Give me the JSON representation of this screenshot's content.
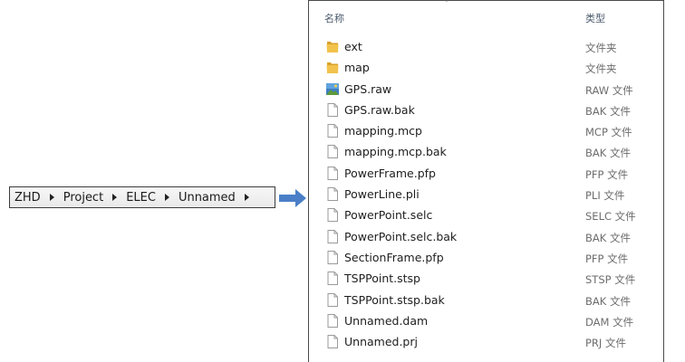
{
  "breadcrumb": {
    "items": [
      "ZHD",
      "Project",
      "ELEC",
      "Unnamed"
    ]
  },
  "explorer": {
    "columns": {
      "name": "名称",
      "type": "类型"
    },
    "files": [
      {
        "name": "ext",
        "type": "文件夹",
        "icon": "folder-icon"
      },
      {
        "name": "map",
        "type": "文件夹",
        "icon": "folder-icon"
      },
      {
        "name": "GPS.raw",
        "type": "RAW 文件",
        "icon": "image-file-icon"
      },
      {
        "name": "GPS.raw.bak",
        "type": "BAK 文件",
        "icon": "file-icon"
      },
      {
        "name": "mapping.mcp",
        "type": "MCP 文件",
        "icon": "file-icon"
      },
      {
        "name": "mapping.mcp.bak",
        "type": "BAK 文件",
        "icon": "file-icon"
      },
      {
        "name": "PowerFrame.pfp",
        "type": "PFP 文件",
        "icon": "file-icon"
      },
      {
        "name": "PowerLine.pli",
        "type": "PLI 文件",
        "icon": "file-icon"
      },
      {
        "name": "PowerPoint.selc",
        "type": "SELC 文件",
        "icon": "file-icon"
      },
      {
        "name": "PowerPoint.selc.bak",
        "type": "BAK 文件",
        "icon": "file-icon"
      },
      {
        "name": "SectionFrame.pfp",
        "type": "PFP 文件",
        "icon": "file-icon"
      },
      {
        "name": "TSPPoint.stsp",
        "type": "STSP 文件",
        "icon": "file-icon"
      },
      {
        "name": "TSPPoint.stsp.bak",
        "type": "BAK 文件",
        "icon": "file-icon"
      },
      {
        "name": "Unnamed.dam",
        "type": "DAM 文件",
        "icon": "file-icon"
      },
      {
        "name": "Unnamed.prj",
        "type": "PRJ 文件",
        "icon": "file-icon"
      }
    ]
  },
  "colors": {
    "arrow": "#4a7fc8",
    "folder": "#e6b23a",
    "header_text": "#4d5b6d",
    "border": "#3c3c3c"
  }
}
